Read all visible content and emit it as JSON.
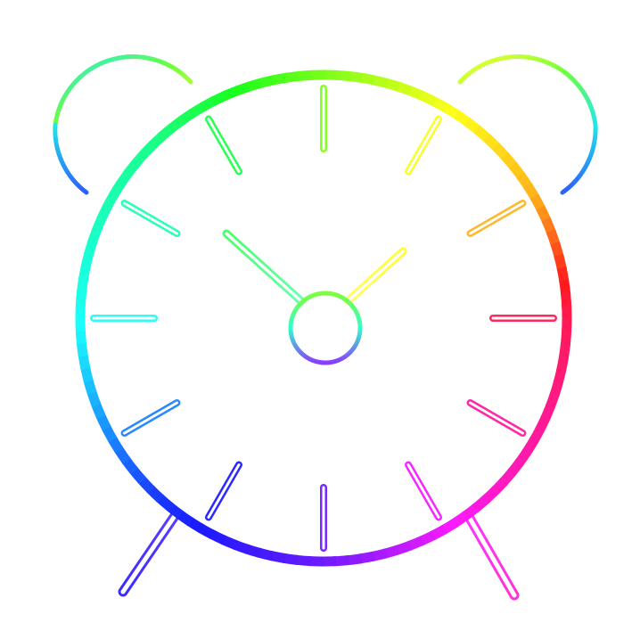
{
  "illustration": {
    "subject": "alarm-clock-icon",
    "style": "rainbow-gradient-outline",
    "time_shown": {
      "hour": 1,
      "minute": 50
    },
    "hour_marks": 12,
    "colors": {
      "top": "#a6ff3a",
      "upper_right": "#ffff33",
      "right": "#ff2f6a",
      "lower_right": "#ff33ff",
      "bottom": "#7a2cff",
      "lower_left": "#3c3cff",
      "left": "#22e8e8",
      "upper_left": "#3cff9a",
      "background": "#ffffff"
    }
  }
}
